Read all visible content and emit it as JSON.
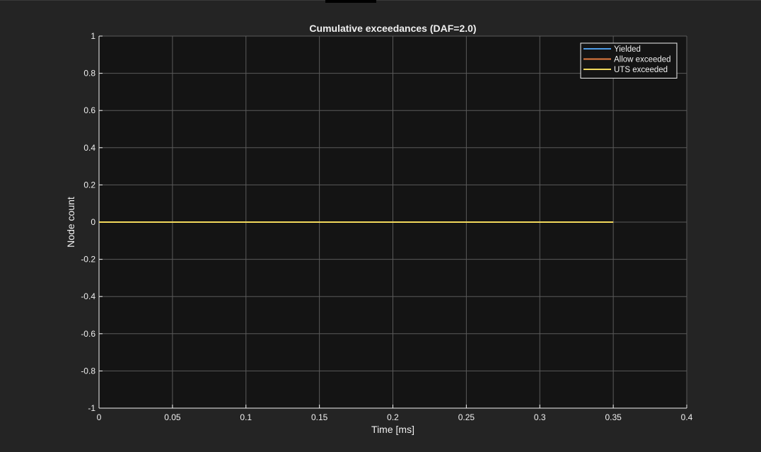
{
  "window": {
    "background": "#242424",
    "axes_background": "#141414",
    "grid_color": "#5a5a5a",
    "axis_color": "#f0f0f0"
  },
  "chart_data": {
    "type": "line",
    "title": "Cumulative exceedances (DAF=2.0)",
    "xlabel": "Time [ms]",
    "ylabel": "Node count",
    "xlim": [
      0,
      0.4
    ],
    "ylim": [
      -1,
      1
    ],
    "xticks": [
      0,
      0.05,
      0.1,
      0.15,
      0.2,
      0.25,
      0.3,
      0.35,
      0.4
    ],
    "xtick_labels": [
      "0",
      "0.05",
      "0.1",
      "0.15",
      "0.2",
      "0.25",
      "0.3",
      "0.35",
      "0.4"
    ],
    "yticks": [
      1,
      0.8,
      0.6,
      0.4,
      0.2,
      0,
      -0.2,
      -0.4,
      -0.6,
      -0.8,
      -1
    ],
    "ytick_labels": [
      "1",
      "0.8",
      "0.6",
      "0.4",
      "0.2",
      "0",
      "-0.2",
      "-0.4",
      "-0.6",
      "-0.8",
      "-1"
    ],
    "grid": true,
    "legend_position": "top-right",
    "series": [
      {
        "name": "Yielded",
        "color": "#4d9be6",
        "x": [
          0,
          0.35
        ],
        "y": [
          0,
          0
        ]
      },
      {
        "name": "Allow exceeded",
        "color": "#e57c3f",
        "x": [
          0,
          0.35
        ],
        "y": [
          0,
          0
        ]
      },
      {
        "name": "UTS exceeded",
        "color": "#f2d95c",
        "x": [
          0,
          0.35
        ],
        "y": [
          0,
          0
        ]
      }
    ]
  }
}
